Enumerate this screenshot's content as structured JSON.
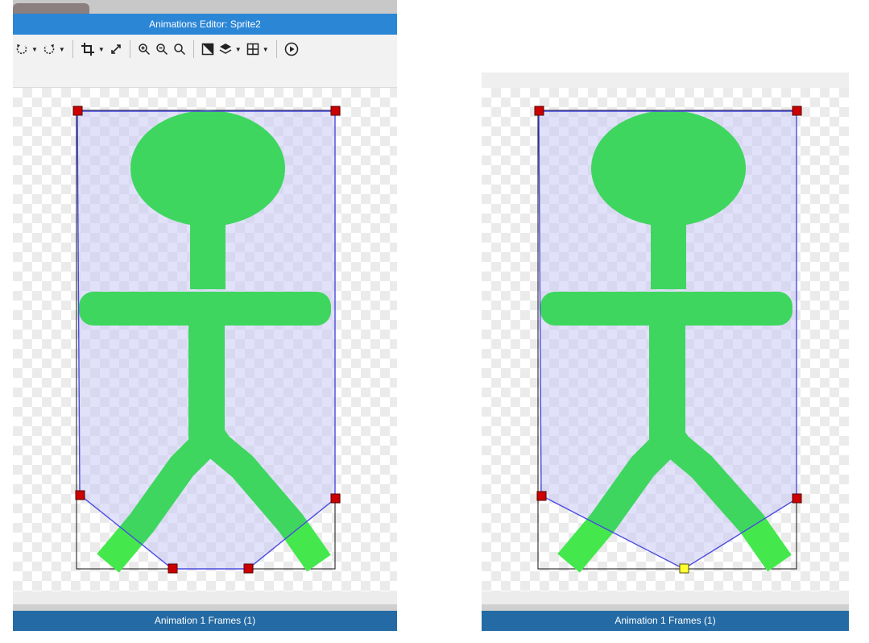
{
  "window": {
    "title": "Animations Editor: Sprite2"
  },
  "toolbar": {
    "icons": [
      "rotate-ccw-icon",
      "rotate-cw-icon",
      "crop-icon",
      "expand-icon",
      "zoom-in-icon",
      "zoom-out-icon",
      "zoom-reset-icon",
      "background-toggle-icon",
      "layers-icon",
      "grid-icon",
      "play-icon"
    ]
  },
  "status": {
    "left_label": "Animation 1 Frames (1)",
    "right_label": "Animation 1 Frames (1)"
  },
  "colors": {
    "accent": "#2b86d6",
    "status_bar": "#246aa4",
    "sprite_green": "#3fd65f",
    "sprite_green_light": "#44e84d",
    "polygon_stroke": "#4a4ae0",
    "polygon_fill": "#c8c8f5",
    "handle_red": "#cc0000",
    "handle_selected": "#ffff33"
  }
}
